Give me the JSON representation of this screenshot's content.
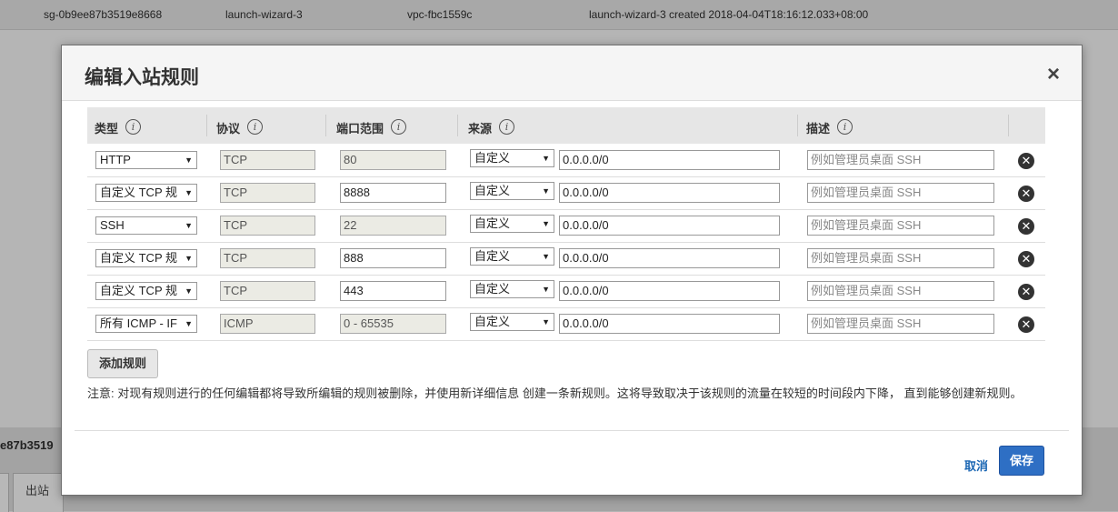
{
  "background": {
    "top_row": {
      "group_id": "sg-0b9ee87b3519e8668",
      "group_name": "launch-wizard-3",
      "vpc": "vpc-fbc1559c",
      "description": "launch-wizard-3 created 2018-04-04T18:16:12.033+08:00"
    },
    "partial_id": "e87b3519",
    "outbound_tab": "出站"
  },
  "modal": {
    "title": "编辑入站规则",
    "close_symbol": "×",
    "columns": {
      "type": "类型",
      "protocol": "协议",
      "port_range": "端口范围",
      "source": "来源",
      "description": "描述"
    },
    "info_symbol": "i",
    "rules": [
      {
        "type": "HTTP",
        "protocol": "TCP",
        "port": "80",
        "source_type": "自定义",
        "source": "0.0.0.0/0",
        "desc_placeholder": "例如管理员桌面 SSH",
        "port_editable": false
      },
      {
        "type": "自定义 TCP 规",
        "protocol": "TCP",
        "port": "8888",
        "source_type": "自定义",
        "source": "0.0.0.0/0",
        "desc_placeholder": "例如管理员桌面 SSH",
        "port_editable": true
      },
      {
        "type": "SSH",
        "protocol": "TCP",
        "port": "22",
        "source_type": "自定义",
        "source": "0.0.0.0/0",
        "desc_placeholder": "例如管理员桌面 SSH",
        "port_editable": false
      },
      {
        "type": "自定义 TCP 规",
        "protocol": "TCP",
        "port": "888",
        "source_type": "自定义",
        "source": "0.0.0.0/0",
        "desc_placeholder": "例如管理员桌面 SSH",
        "port_editable": true
      },
      {
        "type": "自定义 TCP 规",
        "protocol": "TCP",
        "port": "443",
        "source_type": "自定义",
        "source": "0.0.0.0/0",
        "desc_placeholder": "例如管理员桌面 SSH",
        "port_editable": true
      },
      {
        "type": "所有 ICMP - IF",
        "protocol": "ICMP",
        "port": "0 - 65535",
        "source_type": "自定义",
        "source": "0.0.0.0/0",
        "desc_placeholder": "例如管理员桌面 SSH",
        "port_editable": false
      }
    ],
    "add_rule_label": "添加规则",
    "notice": "注意: 对现有规则进行的任何编辑都将导致所编辑的规则被删除，并使用新详细信息 创建一条新规则。这将导致取决于该规则的流量在较短的时间段内下降， 直到能够创建新规则。",
    "cancel_label": "取消",
    "save_label": "保存"
  }
}
